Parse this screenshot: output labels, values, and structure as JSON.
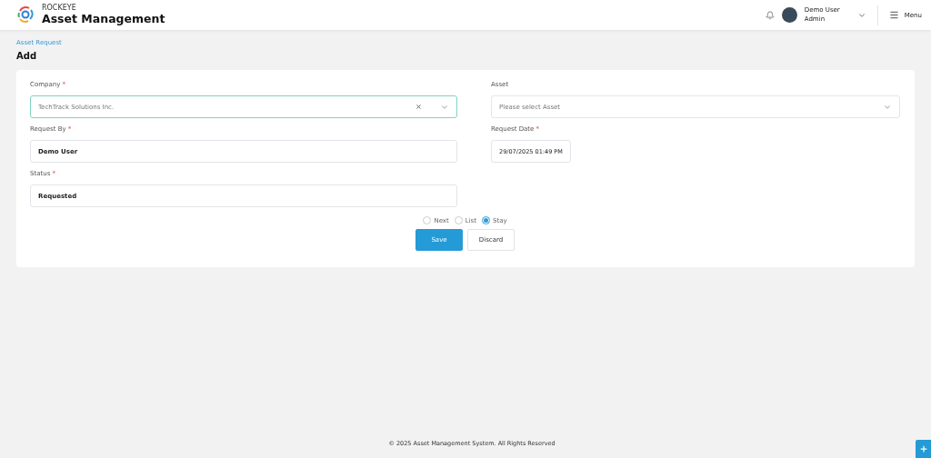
{
  "header": {
    "brand": "ROCKEYE",
    "title": "Asset Management",
    "user": {
      "name": "Demo User",
      "role": "Admin"
    },
    "menu": "Menu"
  },
  "breadcrumb": "Asset Request",
  "page_title": "Add",
  "form": {
    "fields": [
      {
        "kind": "select",
        "label": "Company",
        "required_mark": "*",
        "value": "TechTrack Solutions Inc.",
        "focused": true,
        "clearable": true
      },
      {
        "kind": "select",
        "label": "Asset",
        "placeholder": "Please select Asset",
        "focused": false,
        "clearable": false
      },
      {
        "kind": "text",
        "label": "Request By",
        "required_mark": "*",
        "value": "Demo User"
      },
      {
        "kind": "date",
        "label": "Request Date",
        "required_mark": "*",
        "value": "29/07/2025 01:49 PM"
      },
      {
        "kind": "text",
        "label": "Status",
        "required_mark": "*",
        "value": "Requested"
      }
    ],
    "after_save": [
      {
        "label": "Next",
        "selected": false
      },
      {
        "label": "List",
        "selected": false
      },
      {
        "label": "Stay",
        "selected": true
      }
    ],
    "buttons": [
      {
        "kind": "primary",
        "label": "Save"
      },
      {
        "kind": "secondary",
        "label": "Discard"
      }
    ]
  },
  "footer": "© 2025 Asset Management System. All Rights Reserved"
}
